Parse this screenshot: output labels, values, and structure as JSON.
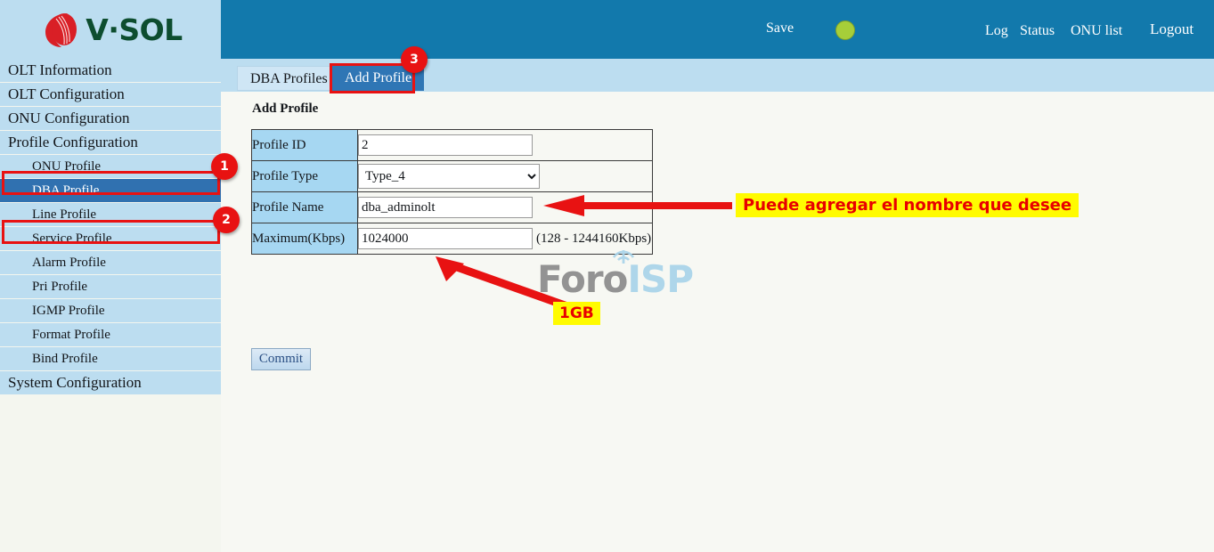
{
  "brand": {
    "logo_text": "V·SOL",
    "logo_icon": "vsol-leaf-logo"
  },
  "header": {
    "save_label": "Save",
    "status_indicator": "green-status-dot",
    "log_label": "Log",
    "status_label": "Status",
    "onu_list_label": "ONU list",
    "logout_label": "Logout"
  },
  "sidebar": {
    "items": [
      {
        "label": "OLT Information",
        "level": "top",
        "active": false
      },
      {
        "label": "OLT Configuration",
        "level": "top",
        "active": false
      },
      {
        "label": "ONU Configuration",
        "level": "top",
        "active": false
      },
      {
        "label": "Profile Configuration",
        "level": "top",
        "active": false
      },
      {
        "label": "ONU Profile",
        "level": "sub",
        "active": false
      },
      {
        "label": "DBA Profile",
        "level": "sub",
        "active": true
      },
      {
        "label": "Line Profile",
        "level": "sub",
        "active": false
      },
      {
        "label": "Service Profile",
        "level": "sub",
        "active": false
      },
      {
        "label": "Alarm Profile",
        "level": "sub",
        "active": false
      },
      {
        "label": "Pri Profile",
        "level": "sub",
        "active": false
      },
      {
        "label": "IGMP Profile",
        "level": "sub",
        "active": false
      },
      {
        "label": "Format Profile",
        "level": "sub",
        "active": false
      },
      {
        "label": "Bind Profile",
        "level": "sub",
        "active": false
      },
      {
        "label": "System Configuration",
        "level": "top",
        "active": false
      }
    ]
  },
  "tabs": [
    {
      "label": "DBA Profiles",
      "active": false
    },
    {
      "label": "Add Profile",
      "active": true
    }
  ],
  "main": {
    "title": "Add Profile",
    "form": {
      "rows": [
        {
          "label": "Profile ID",
          "type": "text",
          "value": "2",
          "hint": ""
        },
        {
          "label": "Profile Type",
          "type": "select",
          "value": "Type_4",
          "hint": ""
        },
        {
          "label": "Profile Name",
          "type": "text",
          "value": "dba_adminolt",
          "hint": ""
        },
        {
          "label": "Maximum(Kbps)",
          "type": "text",
          "value": "1024000",
          "hint": "(128 - 1244160Kbps)"
        }
      ],
      "profile_type_options": [
        "Type_4"
      ],
      "commit_label": "Commit"
    }
  },
  "watermark": {
    "part1": "Foro",
    "part2": "ISP"
  },
  "annotations": {
    "badge_1": "1",
    "badge_2": "2",
    "badge_3": "3",
    "note_name": "Puede agregar el nombre que desee",
    "note_max": "1GB"
  },
  "colors": {
    "header_blue": "#1279ac",
    "sidebar_blue": "#bcddf0",
    "active_item_blue": "#3071b0",
    "tab_active_blue": "#2f76b5",
    "label_cell_blue": "#a6d7f2",
    "content_bg": "#f7f8f3",
    "annotation_red": "#e81212",
    "annotation_yellow": "#fffb00",
    "status_green": "#a6ce39"
  }
}
